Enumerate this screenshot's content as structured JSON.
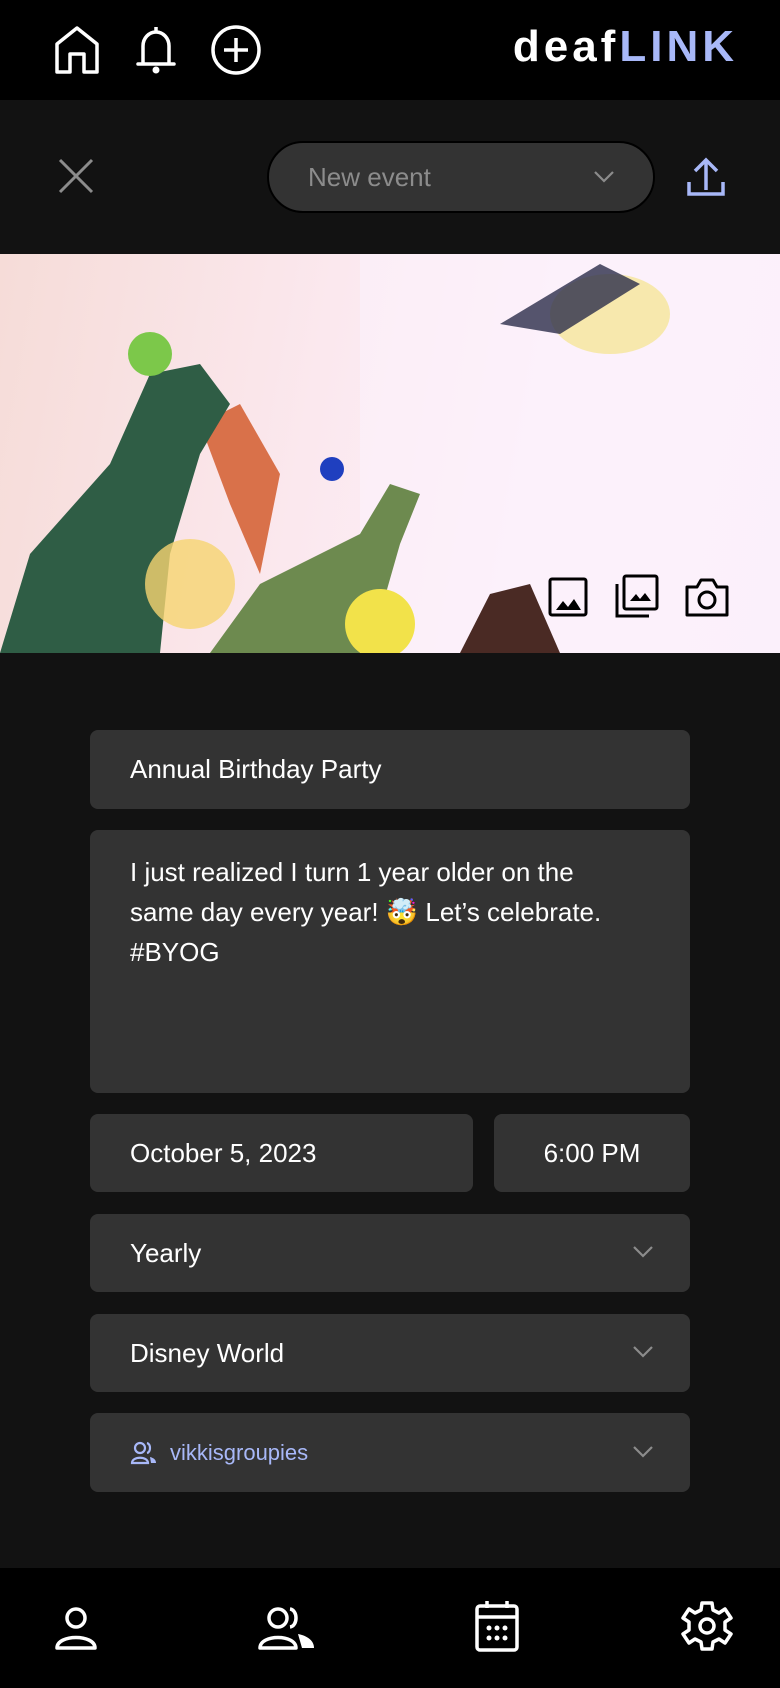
{
  "header": {
    "logo_part1": "deaf",
    "logo_part2": "LINK",
    "icons": [
      "home-icon",
      "bell-icon",
      "plus-circle-icon"
    ]
  },
  "toolbar": {
    "event_type": "New event",
    "close_icon": "close-icon",
    "share_icon": "upload-icon"
  },
  "hero": {
    "icons": [
      "image-icon",
      "gallery-icon",
      "camera-icon"
    ]
  },
  "form": {
    "title": "Annual Birthday Party",
    "description": "I just realized I turn 1 year older on the\nsame day every year! 🤯 Let’s celebrate.\n#BYOG",
    "date": "October 5, 2023",
    "time": "6:00 PM",
    "repeat": "Yearly",
    "location": "Disney World",
    "group": "vikkisgroupies"
  },
  "colors": {
    "accent": "#a8b8f8",
    "field_bg": "#333333",
    "background": "#121212"
  },
  "bottom_nav": [
    "profile-icon",
    "groups-icon",
    "calendar-icon",
    "settings-icon"
  ]
}
